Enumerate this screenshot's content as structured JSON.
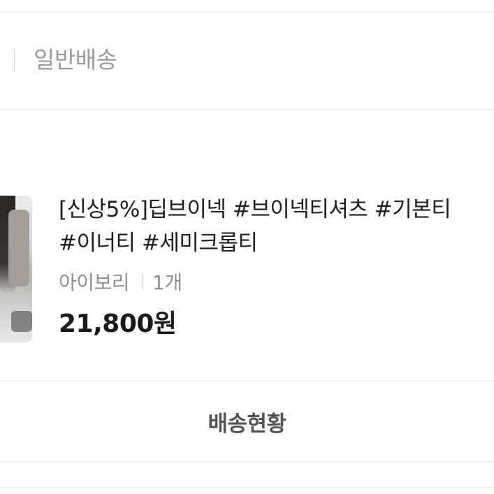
{
  "shipping": {
    "type_label": "일반배송"
  },
  "product": {
    "title_line1": "[신상5%]딥브이넥 #브이넥티셔츠 #기본티",
    "title_line2": "#이너티 #세미크롭티",
    "option_color": "아이보리",
    "quantity": "1개",
    "price": "21,800원"
  },
  "actions": {
    "track_label": "배송현황"
  }
}
